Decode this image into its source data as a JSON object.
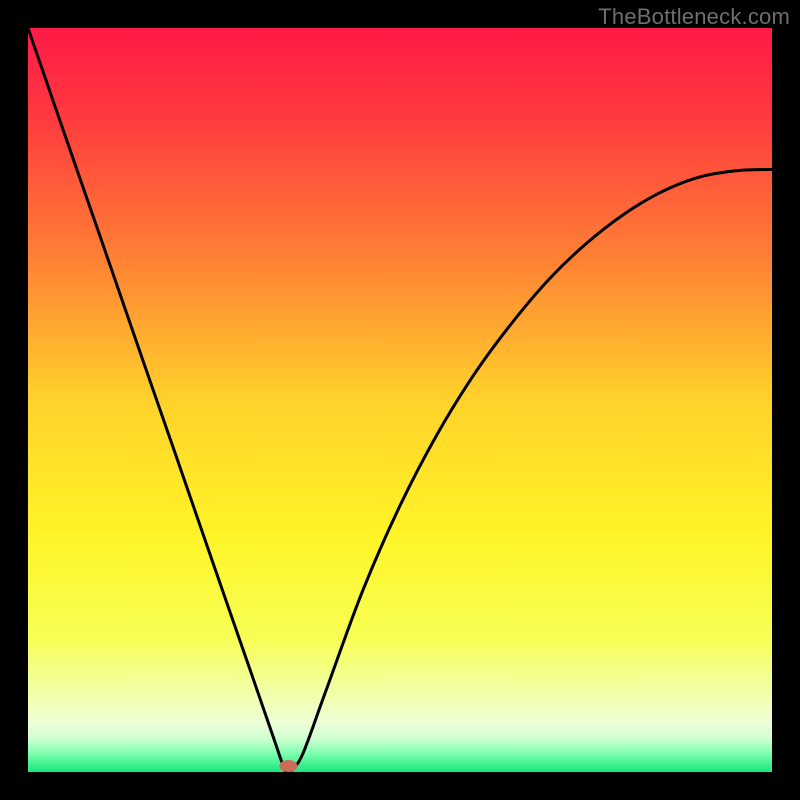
{
  "watermark": "TheBottleneck.com",
  "chart_data": {
    "type": "line",
    "title": "",
    "xlabel": "",
    "ylabel": "",
    "xlim": [
      0,
      1
    ],
    "ylim": [
      0,
      1
    ],
    "series": [
      {
        "name": "bottleneck-curve",
        "x": [
          0.0,
          0.05,
          0.1,
          0.15,
          0.2,
          0.25,
          0.3,
          0.33,
          0.345,
          0.35,
          0.355,
          0.37,
          0.4,
          0.45,
          0.5,
          0.55,
          0.6,
          0.65,
          0.7,
          0.75,
          0.8,
          0.85,
          0.9,
          0.95,
          1.0
        ],
        "y": [
          1.0,
          0.855,
          0.711,
          0.566,
          0.422,
          0.277,
          0.133,
          0.046,
          0.003,
          0.0,
          0.003,
          0.026,
          0.108,
          0.244,
          0.358,
          0.454,
          0.535,
          0.603,
          0.662,
          0.71,
          0.749,
          0.779,
          0.799,
          0.808,
          0.81
        ]
      }
    ],
    "marker": {
      "x": 0.35,
      "y": 0.0,
      "color": "#cd6b5b"
    },
    "gradient_stops": [
      {
        "offset": 0.0,
        "color": "#ff1a46"
      },
      {
        "offset": 0.12,
        "color": "#ff3a3f"
      },
      {
        "offset": 0.3,
        "color": "#ff7d35"
      },
      {
        "offset": 0.5,
        "color": "#ffd22b"
      },
      {
        "offset": 0.68,
        "color": "#fff427"
      },
      {
        "offset": 0.82,
        "color": "#f7ff55"
      },
      {
        "offset": 0.9,
        "color": "#f2ffb0"
      },
      {
        "offset": 0.935,
        "color": "#ecffd8"
      },
      {
        "offset": 0.955,
        "color": "#cfffd0"
      },
      {
        "offset": 0.975,
        "color": "#7dffb0"
      },
      {
        "offset": 1.0,
        "color": "#17e77a"
      }
    ]
  }
}
